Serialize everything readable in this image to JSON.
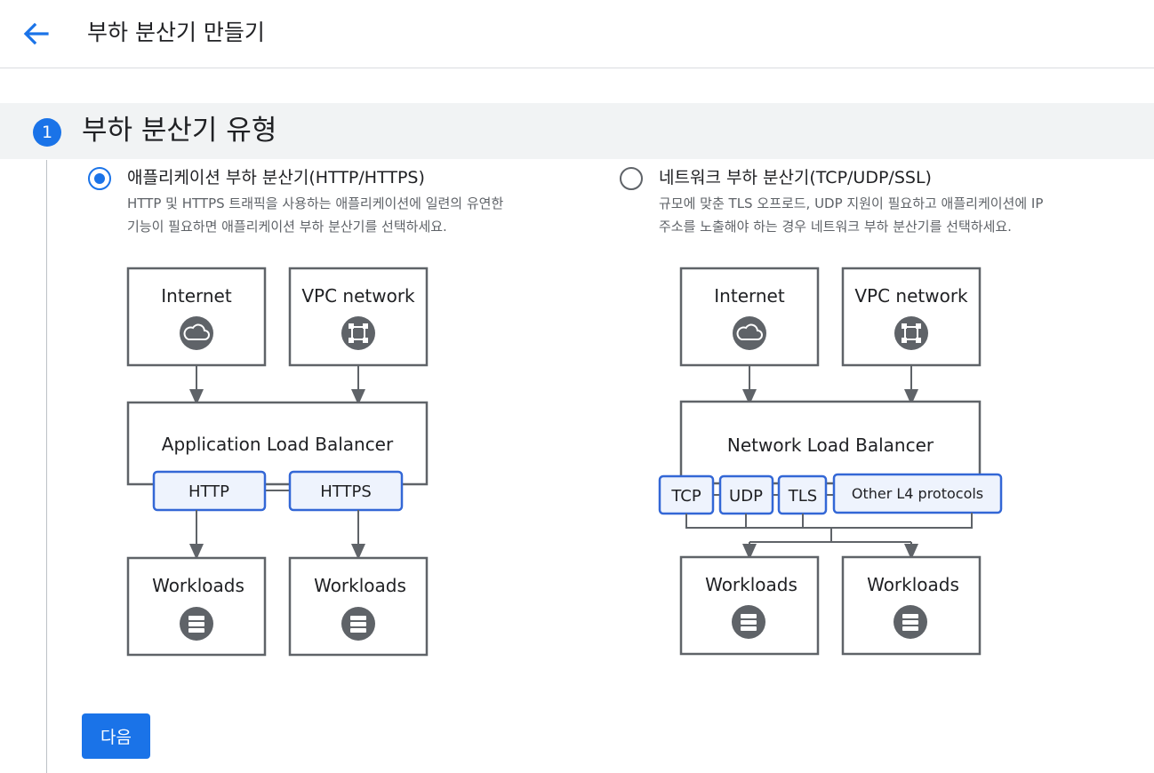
{
  "header": {
    "back_icon": "arrow-back-icon",
    "title": "부하 분산기 만들기"
  },
  "step": {
    "number": "1",
    "title": "부하 분산기 유형"
  },
  "options": [
    {
      "id": "application",
      "selected": true,
      "label": "애플리케이션 부하 분산기(HTTP/HTTPS)",
      "description": [
        "HTTP 및 HTTPS 트래픽을 사용하는 애플리케이션에 일련의 유연한",
        "기능이 필요하면 애플리케이션 부하 분산기를 선택하세요."
      ],
      "diagram": {
        "sources": [
          "Internet",
          "VPC network"
        ],
        "source_icons": [
          "cloud-icon",
          "vpc-network-icon"
        ],
        "balancer": "Application Load Balancer",
        "protocols": [
          "HTTP",
          "HTTPS"
        ],
        "targets": [
          "Workloads",
          "Workloads"
        ],
        "target_icon": "database-icon"
      }
    },
    {
      "id": "network",
      "selected": false,
      "label": "네트워크 부하 분산기(TCP/UDP/SSL)",
      "description": [
        "규모에 맞춘 TLS 오프로드, UDP 지원이 필요하고 애플리케이션에 IP",
        "주소를 노출해야 하는 경우 네트워크 부하 분산기를 선택하세요."
      ],
      "diagram": {
        "sources": [
          "Internet",
          "VPC network"
        ],
        "source_icons": [
          "cloud-icon",
          "vpc-network-icon"
        ],
        "balancer": "Network Load Balancer",
        "protocols": [
          "TCP",
          "UDP",
          "TLS",
          "Other L4 protocols"
        ],
        "targets": [
          "Workloads",
          "Workloads"
        ],
        "target_icon": "database-icon"
      }
    }
  ],
  "next_button": "다음",
  "colors": {
    "accent": "#1a73e8",
    "diagram_border": "#5f6368",
    "protocol_border": "#3367d6",
    "protocol_fill": "#eef3fd"
  }
}
